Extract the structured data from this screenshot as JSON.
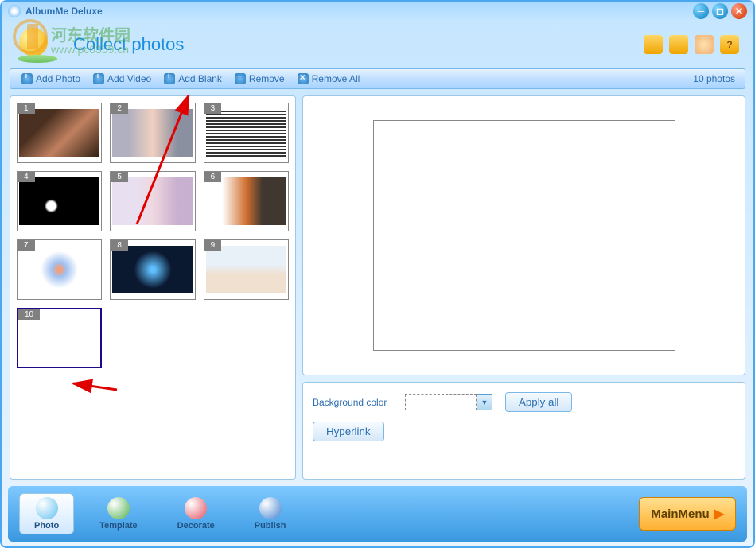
{
  "window": {
    "title": "AlbumMe Deluxe"
  },
  "watermark": {
    "text": "河东软件园",
    "url": "www.pc0359.cn"
  },
  "header": {
    "title": "Collect photos",
    "tools": {
      "folder1": "folder",
      "folder2": "folder",
      "user": "user",
      "help": "?"
    }
  },
  "toolbar": {
    "add_photo": "Add Photo",
    "add_video": "Add Video",
    "add_blank": "Add Blank",
    "remove": "Remove",
    "remove_all": "Remove All",
    "count": "10 photos"
  },
  "thumbs": {
    "n1": "1",
    "n2": "2",
    "n3": "3",
    "n4": "4",
    "n5": "5",
    "n6": "6",
    "n7": "7",
    "n8": "8",
    "n9": "9",
    "n10": "10"
  },
  "props": {
    "bg_label": "Background color",
    "apply_all": "Apply all",
    "hyperlink": "Hyperlink"
  },
  "nav": {
    "photo": "Photo",
    "template": "Template",
    "decorate": "Decorate",
    "publish": "Publish",
    "main_menu": "MainMenu"
  }
}
